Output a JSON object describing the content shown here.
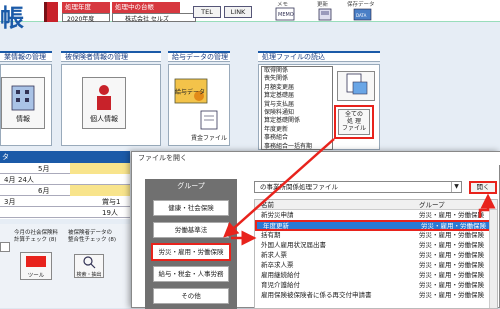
{
  "header": {
    "logo_char": "帳",
    "tab_year_label": "処理年度",
    "tab_ledger_label": "処理中の台帳",
    "year_value": "2020年度",
    "company_value": "株式会社 セルズ",
    "tel_label": "TEL",
    "link_label": "LINK",
    "toolbar": [
      {
        "label": "メモ",
        "icon": "memo-icon"
      },
      {
        "label": "更新",
        "icon": "update-icon"
      },
      {
        "label": "保存データ",
        "icon": "saved-data-icon"
      }
    ]
  },
  "sections": {
    "company_mgmt": "業情報の管理",
    "insured_mgmt": "被保険者情報の管理",
    "salary_mgmt": "給与データの管理",
    "file_read": "処理ファイルの読込"
  },
  "buttons": {
    "company_info": "情報",
    "personal_info": "個人情報",
    "salary_data": "給与データ",
    "wage_file": "賃金ファイル",
    "all_process_file": "全ての\n処 理\nファイル"
  },
  "file_list": [
    "取得関係",
    "喪失関係",
    "月額変更届",
    "算定基礎届",
    "賞与支払届",
    "保険料通知",
    "算定基礎関係",
    "年度更新",
    "事務組合",
    "事務組合一括有期"
  ],
  "left_grid": {
    "header": "タ",
    "rows": [
      {
        "month": "5月",
        "value": ""
      },
      {
        "month": "4月",
        "value": "24人"
      },
      {
        "month": "6月",
        "value": ""
      },
      {
        "month": "3月",
        "value": "賞与1"
      },
      {
        "month": "",
        "value": "19人"
      }
    ]
  },
  "bottom_left": {
    "item1": "今月の社会保険料\n計算チェック (8)",
    "item2": "被保険者データの\n整合性チェック (8)",
    "item3": "ツール",
    "item4": "検索・抽出"
  },
  "dialog": {
    "title": "ファイルを開く",
    "group_header": "グループ",
    "groups": [
      "健康・社会保険",
      "労働基準法",
      "労災・雇用・労働保険",
      "給与・税金・人事労務",
      "その他"
    ],
    "selected_group_index": 2,
    "combo_value": "の事業所関係処理ファイル",
    "open_label": "開く",
    "col_name": "名前",
    "col_group": "グループ",
    "rows": [
      {
        "name": "新労災申請",
        "group": "労災・雇用・労働保険"
      },
      {
        "name": "年度更新",
        "group": "労災・雇用・労働保険"
      },
      {
        "name": "括有期",
        "group": "労災・雇用・労働保険"
      },
      {
        "name": "外国人雇用状況届出書",
        "group": "労災・雇用・労働保険"
      },
      {
        "name": "新求人票",
        "group": "労災・雇用・労働保険"
      },
      {
        "name": "新卒求人票",
        "group": "労災・雇用・労働保険"
      },
      {
        "name": "雇用継続給付",
        "group": "労災・雇用・労働保険"
      },
      {
        "name": "育児介護給付",
        "group": "労災・雇用・労働保険"
      },
      {
        "name": "雇用保険被保険者に係る再交付申請書",
        "group": "労災・雇用・労働保険"
      }
    ],
    "selected_row_index": 1
  },
  "colors": {
    "accent": "#1b5aa8",
    "annotation": "#e8231c",
    "selection": "#2a79d4"
  }
}
